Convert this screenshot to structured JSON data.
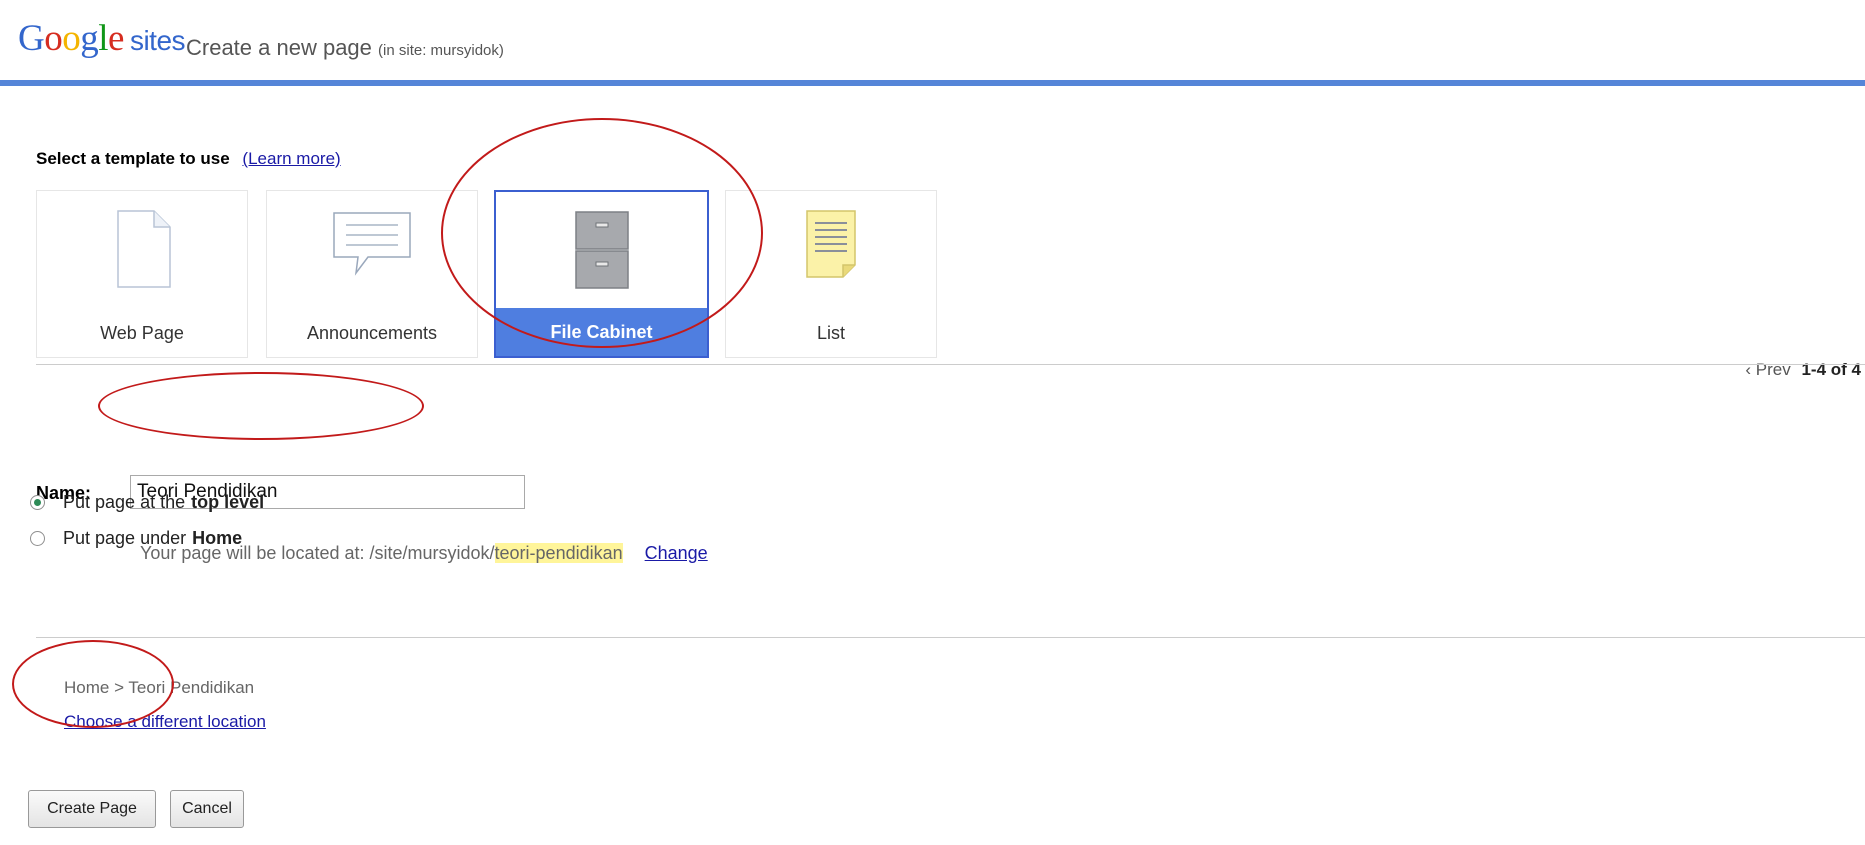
{
  "header": {
    "logo_google": "Google",
    "logo_sites": "sites",
    "title": "Create a new page",
    "site_note": "(in site: mursyidok)",
    "accent_color": "#5585d8"
  },
  "templates": {
    "heading": "Select a template to use",
    "learn_more": "(Learn more)",
    "items": [
      {
        "label": "Web Page",
        "icon": "document-icon",
        "selected": false
      },
      {
        "label": "Announcements",
        "icon": "speech-bubble-icon",
        "selected": false
      },
      {
        "label": "File Cabinet",
        "icon": "file-cabinet-icon",
        "selected": true
      },
      {
        "label": "List",
        "icon": "list-note-icon",
        "selected": false
      }
    ],
    "pager_prev": "‹ Prev",
    "pager_range": "1-4 of 4"
  },
  "form": {
    "name_label": "Name:",
    "name_value": "Teori Pendidikan",
    "location_prefix": "Your page will be located at:  /site/mursyidok/",
    "location_slug": "teori-pendidikan",
    "change_link": "Change",
    "option_top_prefix": "Put page at the",
    "option_top_bold": "top level",
    "option_under_prefix": "Put page under",
    "option_under_bold": "Home",
    "breadcrumb": "Home > Teori Pendidikan",
    "choose_location": "Choose a different location"
  },
  "actions": {
    "create_label": "Create Page",
    "cancel_label": "Cancel"
  }
}
